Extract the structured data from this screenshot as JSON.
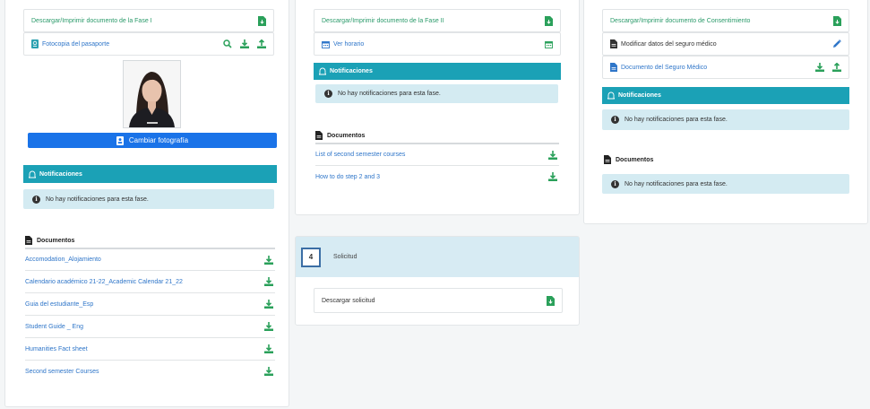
{
  "col1": {
    "phase_doc_label": "Descargar/Imprimir documento de la Fase I",
    "passport_label": "Fotocopia del pasaporte",
    "change_photo_label": "Cambiar fotografía",
    "notifications_title": "Notificaciones",
    "no_notifications": "No hay notificaciones para esta fase.",
    "documents_title": "Documentos",
    "documents": [
      "Accomodation_Alojamiento",
      "Calendario académico 21-22_Academic Calendar 21_22",
      "Guia del estudiante_Esp",
      "Student Guide _ Eng",
      "Humanities Fact sheet",
      "Second semester Courses"
    ]
  },
  "col2": {
    "phase_doc_label": "Descargar/Imprimir documento de la Fase II",
    "schedule_label": "Ver horario",
    "notifications_title": "Notificaciones",
    "no_notifications": "No hay notificaciones para esta fase.",
    "documents_title": "Documentos",
    "documents": [
      "List of second semester courses",
      "How to do step 2 and 3"
    ]
  },
  "col3": {
    "consent_doc_label": "Descargar/Imprimir documento de Consentimiento",
    "insurance_edit_label": "Modificar datos del seguro médico",
    "insurance_doc_label": "Documento del Seguro Médico",
    "notifications_title": "Notificaciones",
    "no_notifications": "No hay notificaciones para esta fase.",
    "documents_title": "Documentos",
    "no_documents": "No hay notificaciones para esta fase."
  },
  "step4": {
    "number": "4",
    "title": "Solicitud",
    "download_label": "Descargar solicitud"
  },
  "colors": {
    "teal": "#1ba1b6",
    "green": "#2a9a6a",
    "link_blue": "#2f76c9",
    "button_blue": "#1a73e8",
    "alert_bg": "#d4ebf2"
  },
  "icons": [
    "file-download-icon",
    "passport-icon",
    "search-icon",
    "download-icon",
    "upload-icon",
    "calendar-icon",
    "bell-icon",
    "info-icon",
    "document-icon",
    "edit-icon",
    "id-card-icon"
  ]
}
